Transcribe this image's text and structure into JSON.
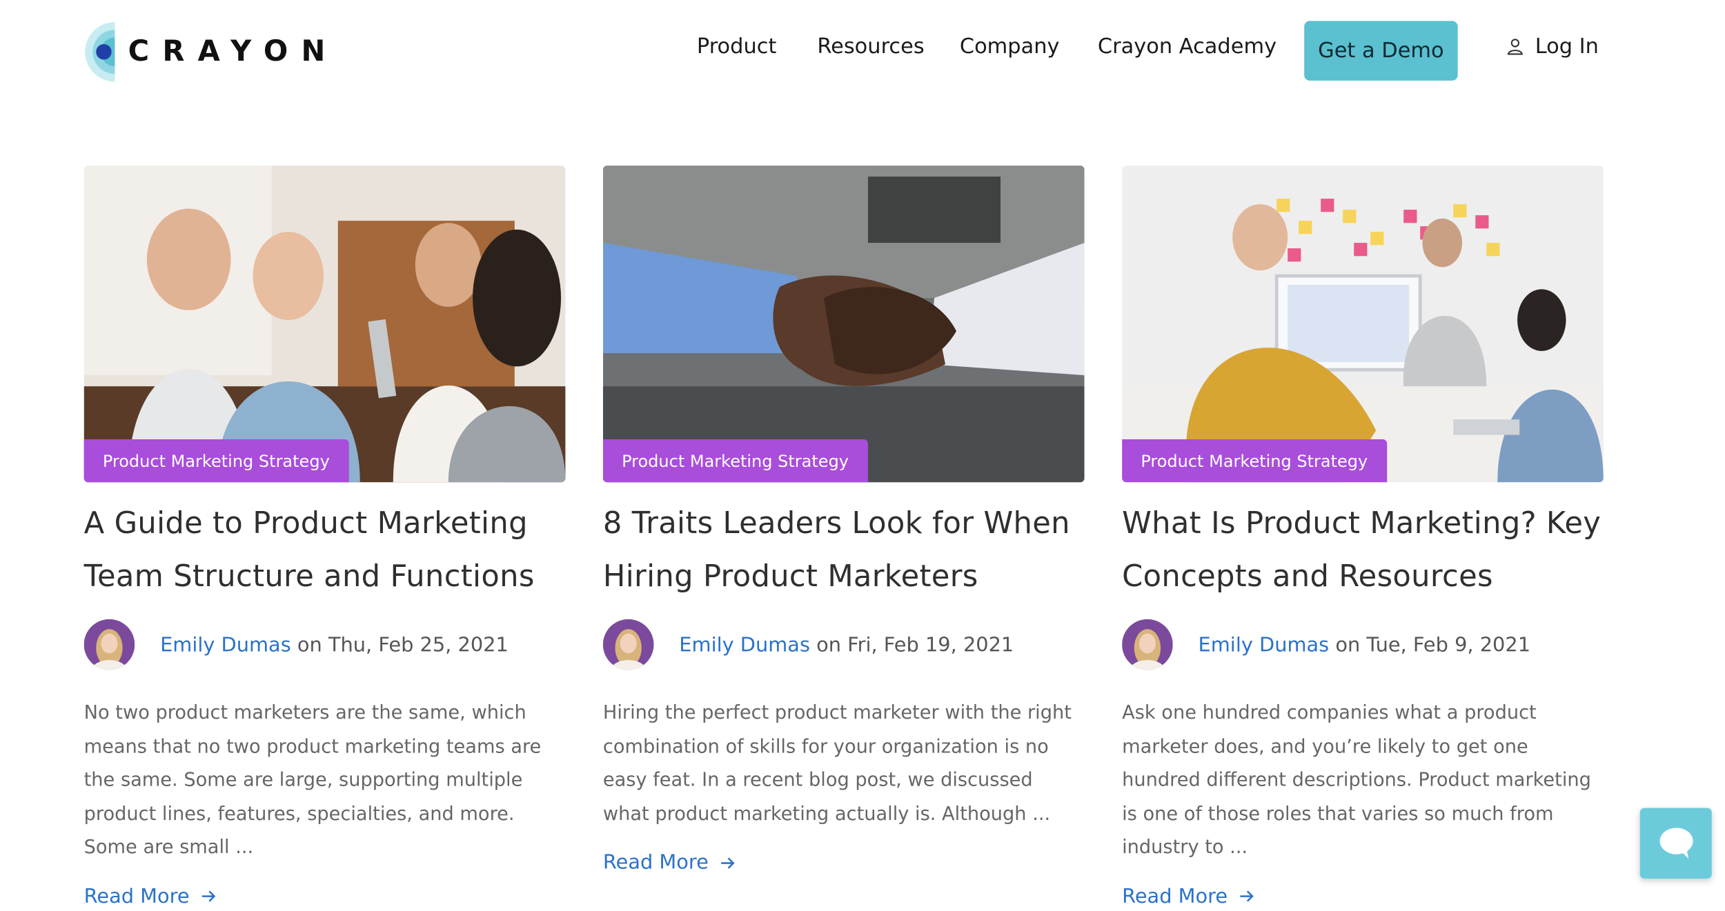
{
  "brand": {
    "name": "CRAYON"
  },
  "nav": {
    "items": [
      "Product",
      "Resources",
      "Company",
      "Crayon Academy"
    ],
    "demo_label": "Get a Demo",
    "login_label": "Log In"
  },
  "posts": [
    {
      "category": "Product Marketing Strategy",
      "title": "A Guide to Product Marketing Team Structure and Functions",
      "author": "Emily Dumas",
      "date_text": " on Thu, Feb 25, 2021",
      "excerpt": "No two product marketers are the same, which means that no two product marketing teams are the same. Some are large, supporting multiple product lines, features, specialties, and more. Some are small ...",
      "read_more": "Read More"
    },
    {
      "category": "Product Marketing Strategy",
      "title": "8 Traits Leaders Look for When Hiring Product Marketers",
      "author": "Emily Dumas",
      "date_text": " on Fri, Feb 19, 2021",
      "excerpt": "Hiring the perfect product marketer with the right combination of skills for your organization is no easy feat. In a recent blog post, we discussed what product marketing actually is. Although ...",
      "read_more": "Read More"
    },
    {
      "category": "Product Marketing Strategy",
      "title": "What Is Product Marketing? Key Concepts and Resources",
      "author": "Emily Dumas",
      "date_text": " on Tue, Feb 9, 2021",
      "excerpt": "Ask one hundred companies what a product marketer does, and you’re likely to get one hundred different descriptions. Product marketing is one of those roles that varies so much from industry to ...",
      "read_more": "Read More"
    }
  ],
  "colors": {
    "accent": "#5bc0cf",
    "tag": "#a94ddb",
    "link": "#2a72c9"
  },
  "icons": {
    "login": "user-icon",
    "read_more": "arrow-right-icon",
    "chat": "chat-bubble-icon"
  }
}
